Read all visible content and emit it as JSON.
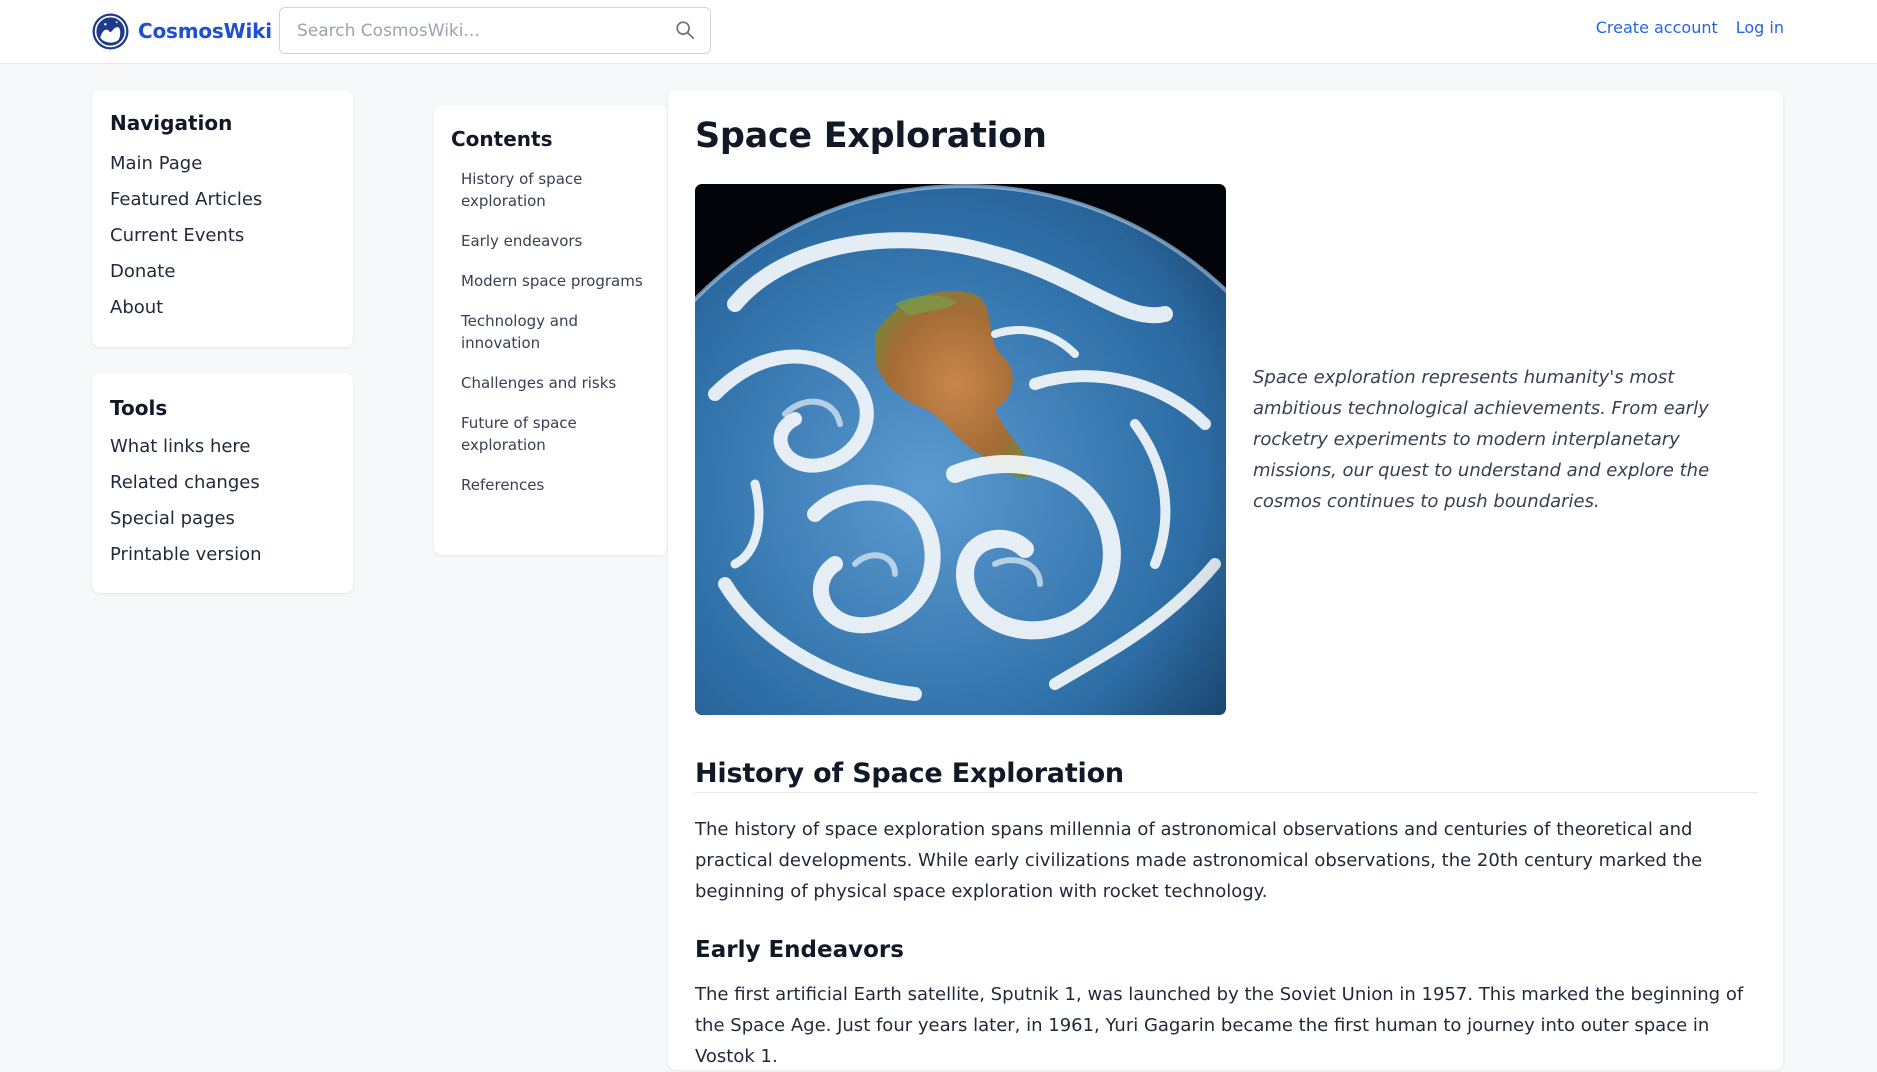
{
  "site": {
    "name": "CosmosWiki",
    "logo_icon": "planet-logo-icon",
    "accent": "#2563eb"
  },
  "search": {
    "placeholder": "Search CosmosWiki...",
    "value": "",
    "icon": "search-icon"
  },
  "account": {
    "create_account": "Create account",
    "log_in": "Log in"
  },
  "navigation": {
    "title": "Navigation",
    "items": [
      "Main Page",
      "Featured Articles",
      "Current Events",
      "Donate",
      "About"
    ]
  },
  "tools": {
    "title": "Tools",
    "items": [
      "What links here",
      "Related changes",
      "Special pages",
      "Printable version"
    ]
  },
  "contents": {
    "title": "Contents",
    "items": [
      "History of space exploration",
      "Early endeavors",
      "Modern space programs",
      "Technology and innovation",
      "Challenges and risks",
      "Future of space exploration",
      "References"
    ]
  },
  "article": {
    "title": "Space Exploration",
    "intro": "Space exploration represents humanity's most ambitious technological achievements. From early rocketry experiments to modern interplanetary missions, our quest to understand and explore the cosmos continues to push boundaries.",
    "sections": [
      {
        "heading": "History of Space Exploration",
        "text": "The history of space exploration spans millennia of astronomical observations and centuries of theoretical and practical developments. While early civilizations made astronomical observations, the 20th century marked the beginning of physical space exploration with rocket technology."
      },
      {
        "heading": "Early Endeavors",
        "text": "The first artificial Earth satellite, Sputnik 1, was launched by the Soviet Union in 1957. This marked the beginning of the Space Age. Just four years later, in 1961, Yuri Gagarin became the first human to journey into outer space in Vostok 1."
      }
    ]
  }
}
